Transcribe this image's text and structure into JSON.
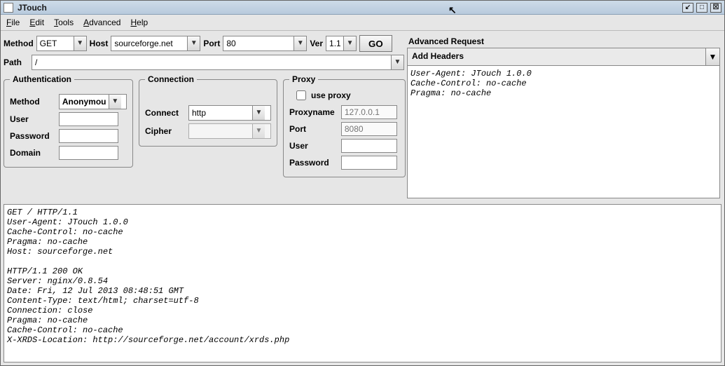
{
  "window": {
    "title": "JTouch"
  },
  "menu": {
    "file": "File",
    "edit": "Edit",
    "tools": "Tools",
    "advanced": "Advanced",
    "help": "Help"
  },
  "request": {
    "method_label": "Method",
    "method": "GET",
    "host_label": "Host",
    "host": "sourceforge.net",
    "port_label": "Port",
    "port": "80",
    "ver_label": "Ver",
    "ver": "1.1",
    "go": "GO",
    "path_label": "Path",
    "path": "/"
  },
  "auth": {
    "legend": "Authentication",
    "method_label": "Method",
    "method": "Anonymous",
    "user_label": "User",
    "user": "",
    "password_label": "Password",
    "password": "",
    "domain_label": "Domain",
    "domain": ""
  },
  "conn": {
    "legend": "Connection",
    "connect_label": "Connect",
    "connect": "http",
    "cipher_label": "Cipher",
    "cipher": ""
  },
  "proxy": {
    "legend": "Proxy",
    "use_label": "use proxy",
    "use": false,
    "name_label": "Proxyname",
    "name_ph": "127.0.0.1",
    "port_label": "Port",
    "port_ph": "8080",
    "user_label": "User",
    "user": "",
    "password_label": "Password",
    "password": ""
  },
  "adv": {
    "title": "Advanced Request",
    "add_headers": "Add Headers",
    "headers_text": "User-Agent: JTouch 1.0.0\nCache-Control: no-cache\nPragma: no-cache"
  },
  "output": "GET / HTTP/1.1\nUser-Agent: JTouch 1.0.0\nCache-Control: no-cache\nPragma: no-cache\nHost: sourceforge.net\n\nHTTP/1.1 200 OK\nServer: nginx/0.8.54\nDate: Fri, 12 Jul 2013 08:48:51 GMT\nContent-Type: text/html; charset=utf-8\nConnection: close\nPragma: no-cache\nCache-Control: no-cache\nX-XRDS-Location: http://sourceforge.net/account/xrds.php"
}
